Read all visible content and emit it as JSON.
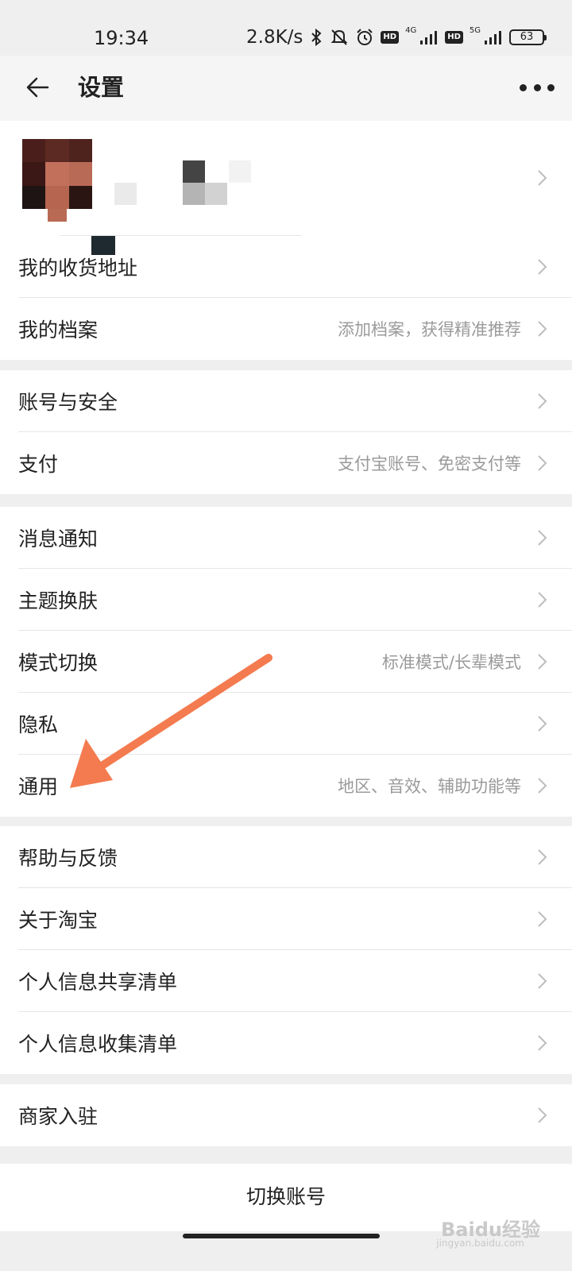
{
  "status_bar": {
    "time": "19:34",
    "net_speed": "2.8K/s",
    "hd1": "HD",
    "net1": "4G",
    "hd2": "HD",
    "net2": "5G",
    "battery": "63",
    "icons": [
      "bluetooth-icon",
      "mute-icon",
      "alarm-icon",
      "signal-icon",
      "battery-icon"
    ]
  },
  "nav": {
    "title": "设置",
    "back_icon": "back-arrow-icon",
    "more_icon": "more-dots-icon"
  },
  "groups": [
    {
      "items": [
        {
          "label": "我的收货地址",
          "sub": ""
        },
        {
          "label": "我的档案",
          "sub": "添加档案，获得精准推荐"
        }
      ]
    },
    {
      "items": [
        {
          "label": "账号与安全",
          "sub": ""
        },
        {
          "label": "支付",
          "sub": "支付宝账号、免密支付等"
        }
      ]
    },
    {
      "items": [
        {
          "label": "消息通知",
          "sub": ""
        },
        {
          "label": "主题换肤",
          "sub": ""
        },
        {
          "label": "模式切换",
          "sub": "标准模式/长辈模式"
        },
        {
          "label": "隐私",
          "sub": ""
        },
        {
          "label": "通用",
          "sub": "地区、音效、辅助功能等"
        }
      ]
    },
    {
      "items": [
        {
          "label": "帮助与反馈",
          "sub": ""
        },
        {
          "label": "关于淘宝",
          "sub": ""
        },
        {
          "label": "个人信息共享清单",
          "sub": ""
        },
        {
          "label": "个人信息收集清单",
          "sub": ""
        }
      ]
    },
    {
      "items": [
        {
          "label": "商家入驻",
          "sub": ""
        }
      ]
    }
  ],
  "switch_account": "切换账号",
  "watermark": {
    "text": "Baidu经验",
    "sub": "jingyan.baidu.com"
  },
  "colors": {
    "accent_arrow": "#f47b4f",
    "background": "#efefef",
    "subtext": "#9a9a9a"
  }
}
